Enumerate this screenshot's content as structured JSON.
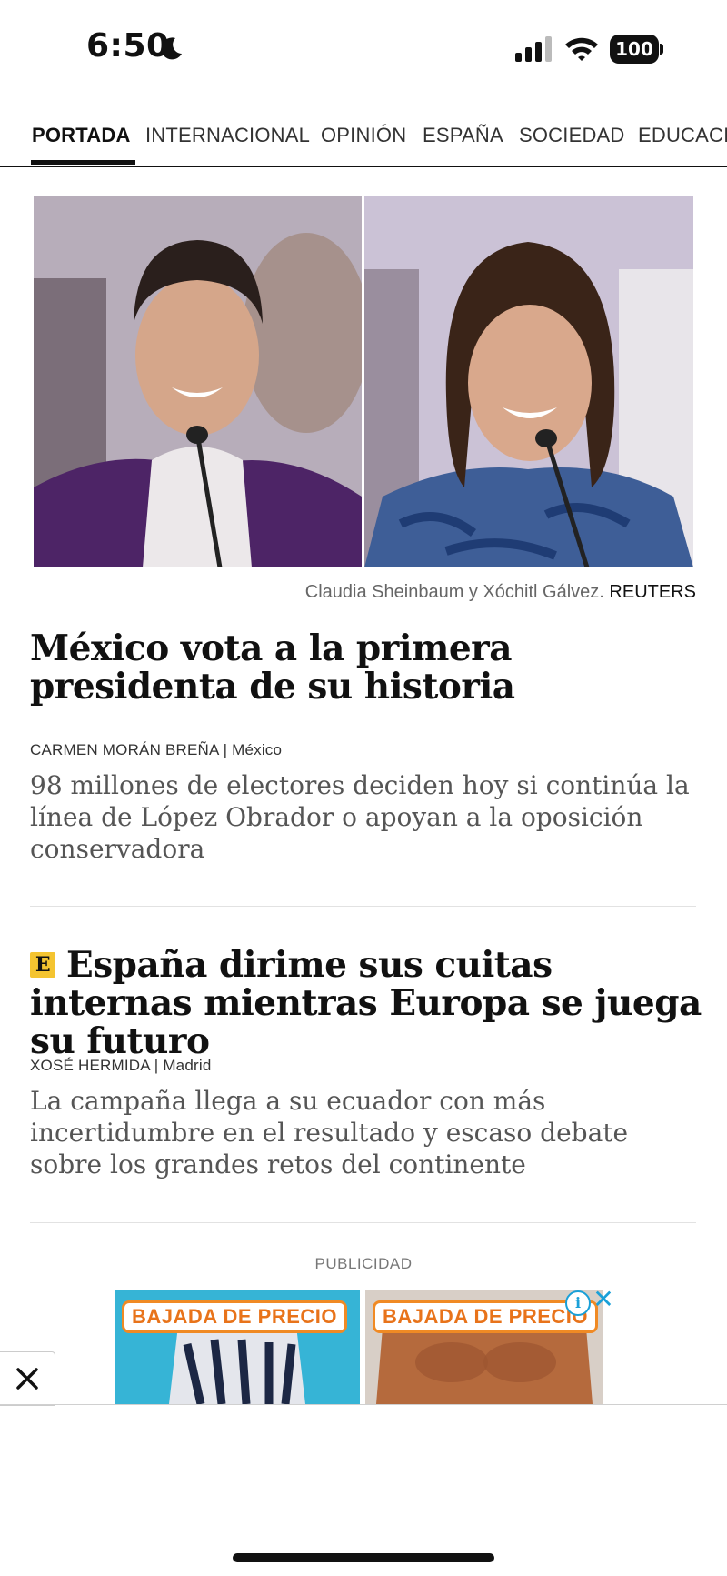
{
  "status_bar": {
    "time": "6:50",
    "battery": "100",
    "icons": [
      "moon-icon",
      "signal-icon",
      "wifi-icon",
      "battery-icon"
    ]
  },
  "nav": {
    "tabs": [
      {
        "label": "PORTADA",
        "active": true
      },
      {
        "label": "INTERNACIONAL"
      },
      {
        "label": "OPINIÓN"
      },
      {
        "label": "ESPAÑA"
      },
      {
        "label": "SOCIEDAD"
      },
      {
        "label": "EDUCACIÓN"
      }
    ]
  },
  "hero": {
    "caption": "Claudia Sheinbaum y Xóchitl Gálvez.",
    "credit": "REUTERS"
  },
  "articles": [
    {
      "headline": "México vota a la primera presidenta de su historia",
      "author": "CARMEN MORÁN BREÑA",
      "location": "México",
      "summary": "98 millones de electores deciden hoy si continúa la línea de López Obrador o apoyan a la oposición conservadora"
    },
    {
      "badge": "E",
      "headline": "España dirime sus cuitas internas mientras Europa se juega su futuro",
      "author": "XOSÉ HERMIDA",
      "location": "Madrid",
      "summary": "La campaña llega a su ecuador con más incertidumbre en el resultado y escaso debate sobre los grandes retos del continente"
    }
  ],
  "ad": {
    "label": "PUBLICIDAD",
    "items": [
      {
        "tag": "BAJADA DE PRECIO"
      },
      {
        "tag": "BAJADA DE PRECIO"
      }
    ],
    "info": "i",
    "close": "✕",
    "dismiss": "✕"
  },
  "colors": {
    "accent_badge": "#f4c430",
    "ad_tag": "#e8731a",
    "ad_choice": "#1aa0d8"
  }
}
